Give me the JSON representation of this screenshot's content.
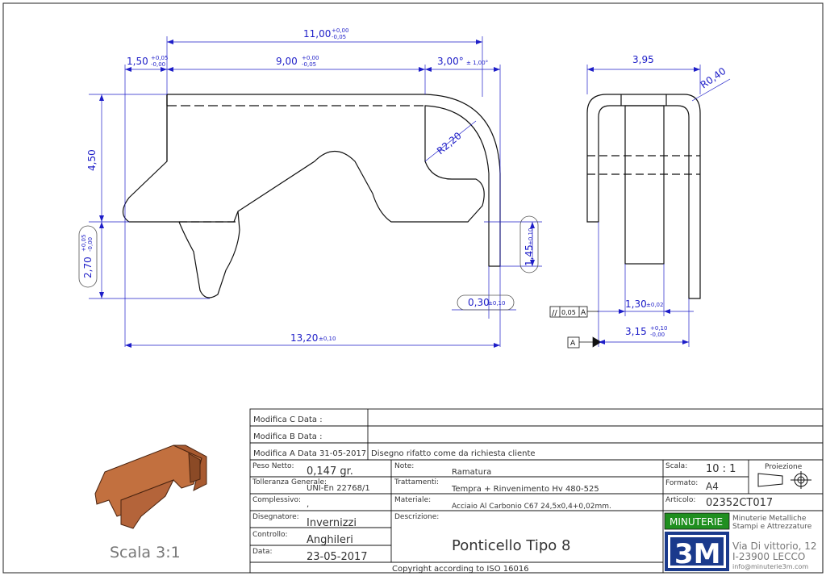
{
  "dimensions": {
    "d11": "11,00",
    "d11_tol_up": "+0,00",
    "d11_tol_dn": "-0,05",
    "d150": "1,50",
    "d150_tol_up": "+0,05",
    "d150_tol_dn": "-0,00",
    "d9": "9,00",
    "d9_tol_up": "+0,00",
    "d9_tol_dn": "-0,05",
    "d3deg": "3,00°",
    "d3deg_tol": "± 1,00°",
    "d450": "4,50",
    "r220": "R2,20",
    "d270": "2,70",
    "d270_tol_up": "+0,05",
    "d270_tol_dn": "-0,00",
    "d145": "1,45",
    "d145_tol": "±0,10",
    "d030": "0,30",
    "d030_tol": "±0,10",
    "d1320": "13,20",
    "d1320_tol": "±0,10",
    "d395": "3,95",
    "r040": "R0,40",
    "d130": "1,30",
    "d130_tol": "±0,02",
    "d315": "3,15",
    "d315_tol_up": "+0,10",
    "d315_tol_dn": "-0,00",
    "parallel_tol": "0,05",
    "datum": "A"
  },
  "title_block": {
    "mod_c": "Modifica C Data :",
    "mod_b": "Modifica B Data :",
    "mod_a": "Modifica A Data 31-05-2017",
    "mod_a_desc": "Disegno rifatto come da richiesta cliente",
    "peso_label": "Peso Netto:",
    "peso_value": "0,147  gr.",
    "tolleranza_label": "Tolleranza Generale:",
    "tolleranza_value": "UNI-En 22768/1",
    "complessivo_label": "Complessivo:",
    "complessivo_value": ",",
    "disegnatore_label": "Disegnatore:",
    "disegnatore_value": "Invernizzi",
    "controllo_label": "Controllo:",
    "controllo_value": "Anghileri",
    "data_label": "Data:",
    "data_value": "23-05-2017",
    "note_label": "Note:",
    "note_value": "Ramatura",
    "trattamenti_label": "Trattamenti:",
    "trattamenti_value": "Tempra + Rinvenimento Hv 480-525",
    "materiale_label": "Materiale:",
    "materiale_value": "Acciaio Al Carbonio C67 24,5x0,4+0,02mm.",
    "descrizione_label": "Descrizione:",
    "descrizione_value": "Ponticello Tipo 8",
    "scala_label": "Scala:",
    "scala_value": "10 : 1",
    "formato_label": "Formato:",
    "formato_value": "A4",
    "articolo_label": "Articolo:",
    "articolo_value": "02352CT017",
    "proiezione_label": "Proiezione",
    "company_badge": "MINUTERIE",
    "company_line1": "Minuterie Metalliche",
    "company_line2": "Stampi e Attrezzature",
    "logo": "3M",
    "address1": "Via Di vittorio, 12",
    "address2": "I-23900 LECCO",
    "email": "info@minuterie3m.com",
    "copyright": "Copyright according to ISO 16016"
  },
  "preview": {
    "scale_label": "Scala 3:1"
  },
  "colors": {
    "dimension": "#1e1ec8",
    "copper": "#c2703f",
    "badge_green": "#1f8f1f",
    "logo_blue": "#1a3a8c"
  }
}
